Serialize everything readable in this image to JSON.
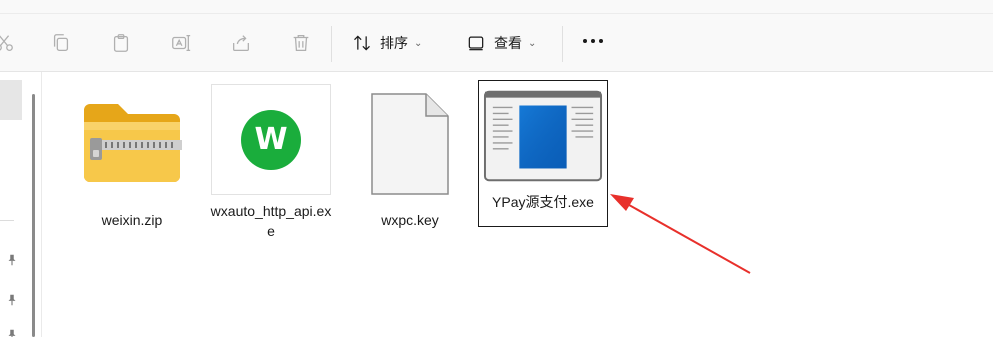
{
  "toolbar": {
    "icons": [
      "cut-icon",
      "copy-icon",
      "paste-icon",
      "rename-icon",
      "share-icon",
      "delete-icon"
    ],
    "sort_label": "排序",
    "view_label": "查看",
    "more_icon": "more-options-icon"
  },
  "files": [
    {
      "name": "weixin.zip",
      "icon": "zip-folder-icon"
    },
    {
      "name": "wxauto_http_api.exe",
      "icon": "wechat-app-icon",
      "thumb_letter": "W"
    },
    {
      "name": "wxpc.key",
      "icon": "blank-file-icon"
    },
    {
      "name": "YPay源支付.exe",
      "icon": "exe-window-icon",
      "selected": true
    }
  ],
  "annotation": {
    "type": "red-arrow",
    "color": "#e8302b"
  },
  "colors": {
    "accent": "#0a64c2",
    "wechat_green": "#1aad3c",
    "zip_yellow": "#f5c044"
  }
}
